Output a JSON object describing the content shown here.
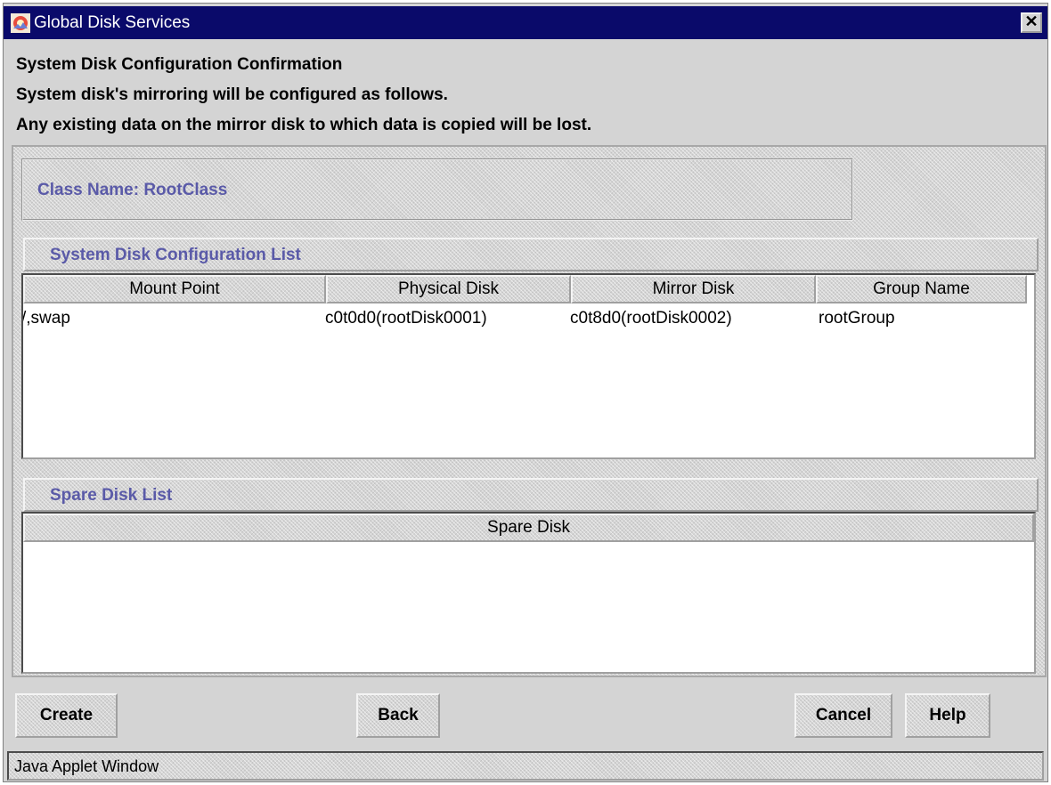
{
  "window": {
    "title": "Global Disk Services",
    "close_symbol": "✕"
  },
  "header": {
    "line1": "System Disk Configuration Confirmation",
    "line2": "System disk's mirroring will be configured as follows.",
    "line3": "Any existing data on the mirror disk to which data is copied will be lost."
  },
  "class_info": {
    "label": "Class Name: RootClass"
  },
  "config_list": {
    "title": "System Disk Configuration List",
    "columns": [
      "Mount Point",
      "Physical Disk",
      "Mirror Disk",
      "Group Name"
    ],
    "rows": [
      [
        "/,swap",
        "c0t0d0(rootDisk0001)",
        "c0t8d0(rootDisk0002)",
        "rootGroup"
      ]
    ]
  },
  "spare_list": {
    "title": "Spare Disk List",
    "columns": [
      "Spare Disk"
    ],
    "rows": []
  },
  "buttons": {
    "create": "Create",
    "back": "Back",
    "cancel": "Cancel",
    "help": "Help"
  },
  "status": {
    "text": "Java Applet Window"
  },
  "icons": {
    "app": "gds-app-icon",
    "close": "close-icon"
  },
  "colors": {
    "titlebar": "#0a0a6a",
    "section_label": "#5a5aa8",
    "window_bg": "#d4d4d4"
  }
}
